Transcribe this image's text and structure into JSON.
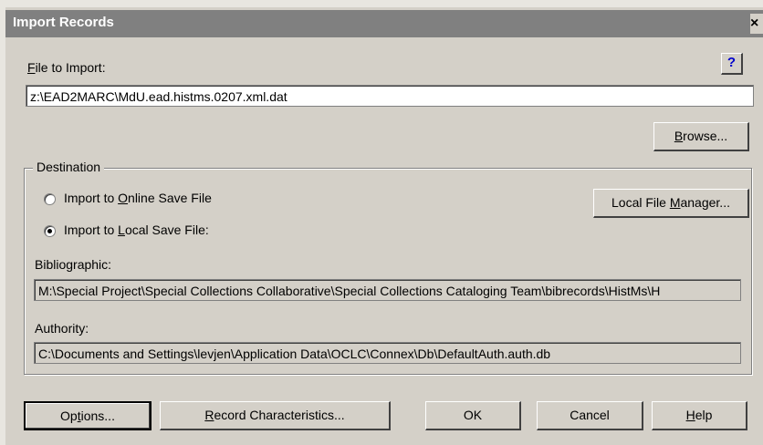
{
  "window": {
    "title": "Import Records",
    "close_glyph": "×"
  },
  "file_to_import": {
    "label": "File to Import:",
    "accesskey": "F",
    "value": "z:\\EAD2MARC\\MdU.ead.histms.0207.xml.dat"
  },
  "help_icon": {
    "glyph": "?"
  },
  "browse_button": {
    "label": "Browse..."
  },
  "destination": {
    "title": "Destination",
    "online_option": {
      "label": "Import to Online Save File",
      "checked": false
    },
    "local_option": {
      "label": "Import to Local Save File:",
      "checked": true
    },
    "local_file_manager_button": {
      "label": "Local File Manager..."
    },
    "bibliographic": {
      "label": "Bibliographic:",
      "value": "M:\\Special Project\\Special Collections Collaborative\\Special Collections Cataloging Team\\bibrecords\\HistMs\\H"
    },
    "authority": {
      "label": "Authority:",
      "value": "C:\\Documents and Settings\\levjen\\Application Data\\OCLC\\Connex\\Db\\DefaultAuth.auth.db"
    }
  },
  "footer": {
    "options_label": "Options...",
    "record_characteristics_label": "Record Characteristics...",
    "ok_label": "OK",
    "cancel_label": "Cancel",
    "help_label": "Help"
  }
}
